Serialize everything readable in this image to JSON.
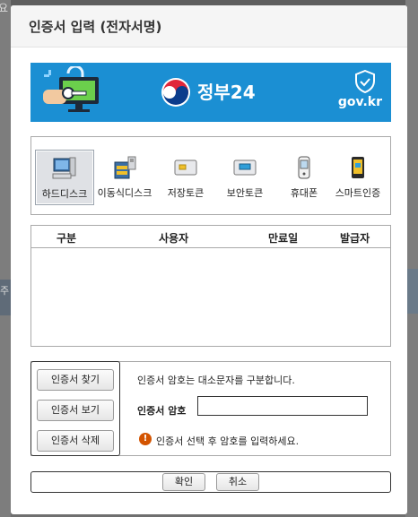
{
  "background": {
    "fragment_left_top": "요",
    "fragment_left_mid": "주"
  },
  "dialog": {
    "title": "인증서 입력 (전자서명)"
  },
  "banner": {
    "brand": "정부24",
    "domain": "gov.kr",
    "bg_color": "#1b8fd3"
  },
  "media": {
    "selected": "하드디스크",
    "items": [
      {
        "label": "하드디스크",
        "icon": "desktop-computer-icon"
      },
      {
        "label": "이동식디스크",
        "icon": "removable-disk-icon"
      },
      {
        "label": "저장토큰",
        "icon": "storage-token-icon"
      },
      {
        "label": "보안토큰",
        "icon": "security-token-icon"
      },
      {
        "label": "휴대폰",
        "icon": "mobile-phone-icon"
      },
      {
        "label": "스마트인증",
        "icon": "smart-auth-icon"
      }
    ]
  },
  "cert_table": {
    "columns": [
      "구분",
      "사용자",
      "만료일",
      "발급자"
    ],
    "rows": []
  },
  "actions": {
    "find_label": "인증서 찾기",
    "view_label": "인증서 보기",
    "delete_label": "인증서 삭제",
    "notice": "인증서 암호는 대소문자를 구분합니다.",
    "password_label": "인증서 암호",
    "password_value": "",
    "warning": "인증서 선택 후 암호를 입력하세요."
  },
  "footer": {
    "confirm_label": "확인",
    "cancel_label": "취소"
  }
}
